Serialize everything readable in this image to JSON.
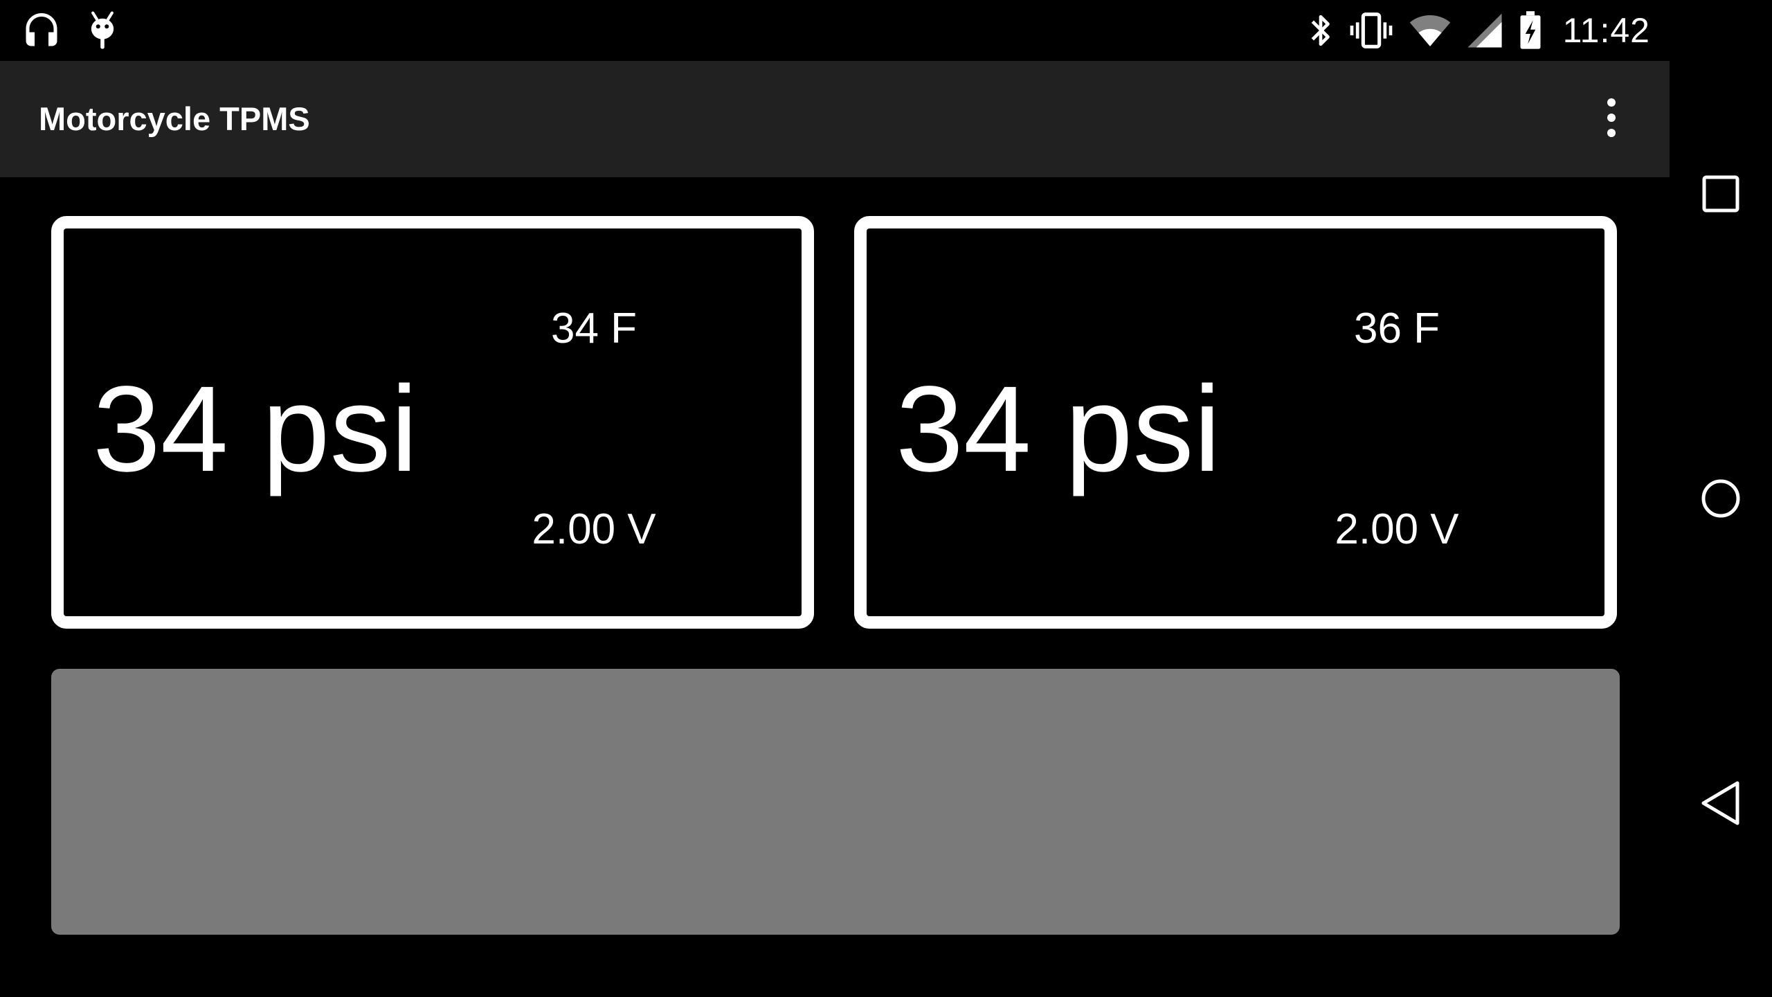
{
  "status_bar": {
    "time": "11:42",
    "left_icons": [
      "headset-icon",
      "android-debug-icon"
    ],
    "right_icons": [
      "bluetooth-icon",
      "vibrate-icon",
      "wifi-icon",
      "cell-signal-icon",
      "battery-charging-icon"
    ]
  },
  "app_bar": {
    "title": "Motorcycle TPMS",
    "menu_icon": "overflow-menu-icon"
  },
  "tires": [
    {
      "pressure": "34 psi",
      "temperature": "34 F",
      "voltage": "2.00 V"
    },
    {
      "pressure": "34 psi",
      "temperature": "36 F",
      "voltage": "2.00 V"
    }
  ],
  "nav_bar": {
    "icons": [
      "recents-icon",
      "home-icon",
      "back-icon"
    ]
  },
  "colors": {
    "background": "#000000",
    "app_bar": "#212121",
    "card_border": "#ffffff",
    "panel": "#7a7a7a",
    "text": "#ffffff"
  }
}
